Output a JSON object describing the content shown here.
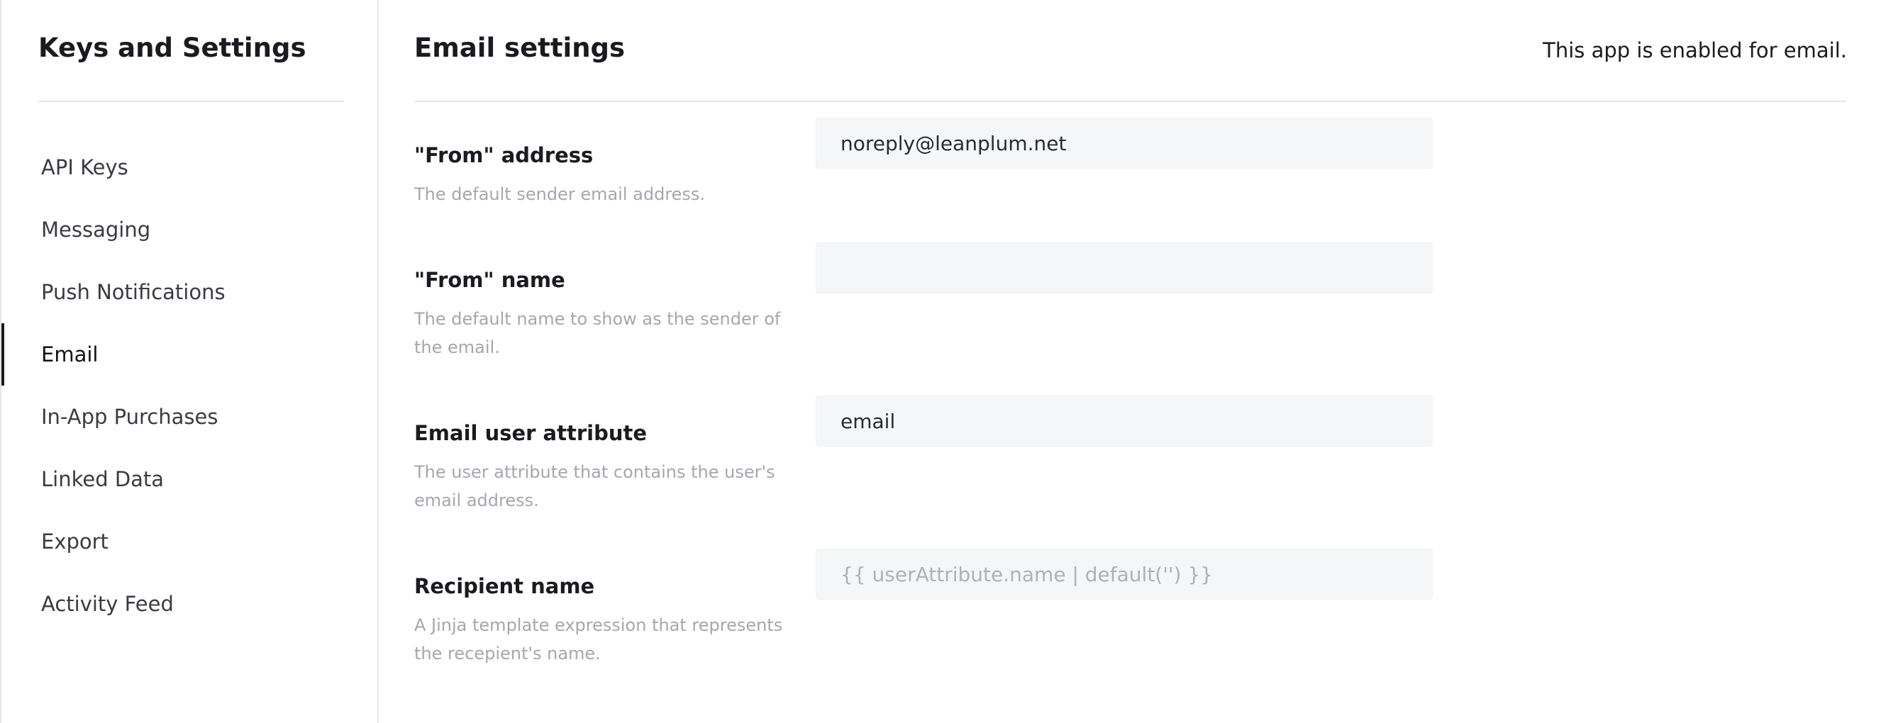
{
  "sidebar": {
    "title": "Keys and Settings",
    "items": [
      {
        "label": "API Keys"
      },
      {
        "label": "Messaging"
      },
      {
        "label": "Push Notifications"
      },
      {
        "label": "Email"
      },
      {
        "label": "In-App Purchases"
      },
      {
        "label": "Linked Data"
      },
      {
        "label": "Export"
      },
      {
        "label": "Activity Feed"
      }
    ],
    "active_item": "Email"
  },
  "main": {
    "title": "Email settings",
    "status": "This app is enabled for email.",
    "fields": {
      "from_address": {
        "label": "\"From\" address",
        "help": "The default sender email address.",
        "value": "noreply@leanplum.net",
        "placeholder": ""
      },
      "from_name": {
        "label": "\"From\" name",
        "help": "The default name to show as the sender of the email.",
        "value": "",
        "placeholder": ""
      },
      "email_attribute": {
        "label": "Email user attribute",
        "help": "The user attribute that contains the user's email address.",
        "value": "email",
        "placeholder": ""
      },
      "recipient_name": {
        "label": "Recipient name",
        "help": "A Jinja template expression that represents the recepient's name.",
        "value": "",
        "placeholder": "{{ userAttribute.name | default('') }}"
      }
    }
  },
  "colors": {
    "text_primary": "#1a1a20",
    "text_help": "#a6a6ae",
    "input_bg": "#f5f6f8",
    "divider": "#e6e6ea",
    "active_indicator": "#1a1a20"
  }
}
